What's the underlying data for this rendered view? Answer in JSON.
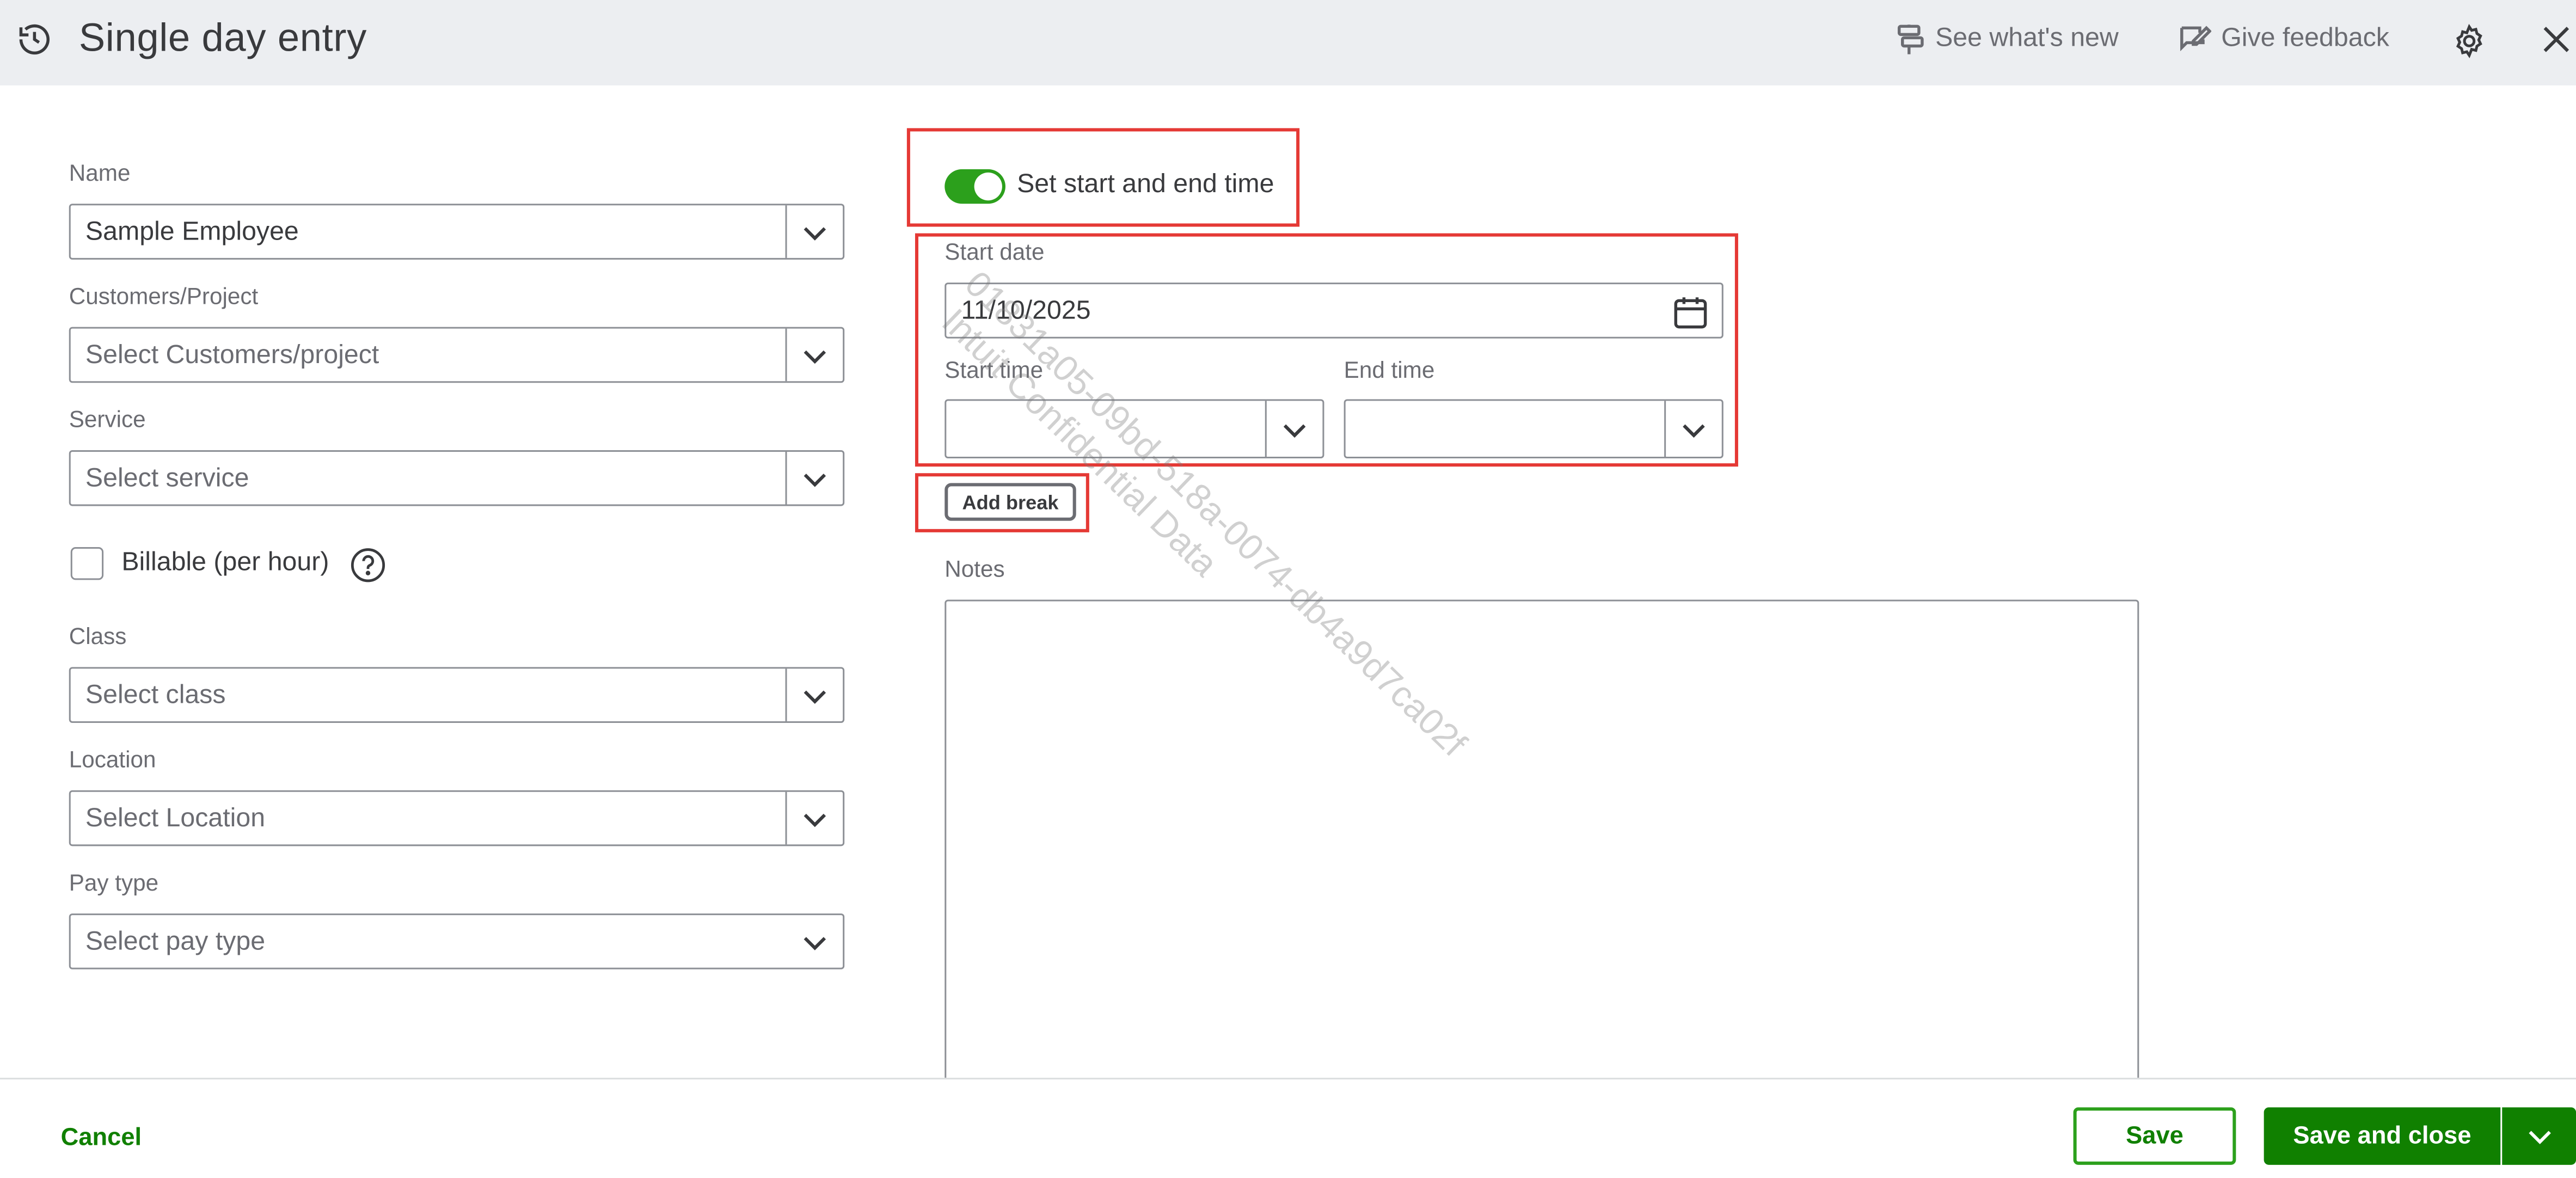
{
  "header": {
    "title": "Single day entry",
    "whats_new": "See what's new",
    "feedback": "Give feedback"
  },
  "form": {
    "name_label": "Name",
    "name_value": "Sample Employee",
    "customer_label": "Customers/Project",
    "customer_placeholder": "Select Customers/project",
    "service_label": "Service",
    "service_placeholder": "Select service",
    "billable_label": "Billable (per hour)",
    "billable_checked": false,
    "class_label": "Class",
    "class_placeholder": "Select class",
    "location_label": "Location",
    "location_placeholder": "Select Location",
    "paytype_label": "Pay type",
    "paytype_placeholder": "Select pay type"
  },
  "time": {
    "toggle_label": "Set start and end time",
    "toggle_on": true,
    "start_date_label": "Start date",
    "start_date_value": "11/10/2025",
    "start_time_label": "Start time",
    "start_time_value": "",
    "end_time_label": "End time",
    "end_time_value": "",
    "add_break": "Add break",
    "notes_label": "Notes",
    "notes_value": ""
  },
  "footer": {
    "cancel": "Cancel",
    "save": "Save",
    "save_close": "Save and close"
  },
  "watermark": {
    "line1": "01831a05-09bd-518a-0074-db4a9d7ca02f",
    "line2": "Intuit Confidential Data"
  },
  "colors": {
    "brand_green": "#2ca01c",
    "dark_green": "#108000",
    "highlight_red": "#e53935",
    "header_bg": "#eceef1"
  },
  "icons": {
    "history": "history-icon",
    "whats_new": "signpost-icon",
    "feedback": "feedback-icon",
    "settings": "gear-icon",
    "close": "close-icon",
    "calendar": "calendar-icon",
    "dropdown": "chevron-down-icon",
    "help": "help-circle-icon"
  }
}
